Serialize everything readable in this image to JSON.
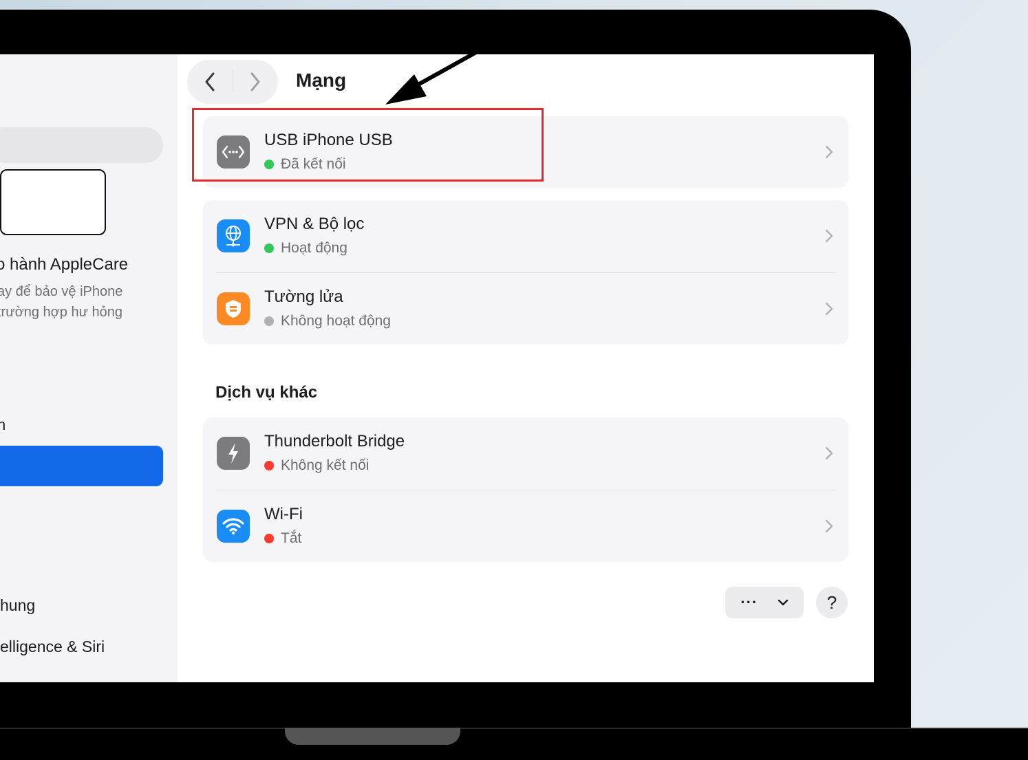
{
  "window": {
    "title": "Mạng"
  },
  "sidebar": {
    "applecare_title": "o hành AppleCare",
    "applecare_desc_line1": "ay để bảo vệ iPhone",
    "applecare_desc_line2": "trường hợp hư hỏng",
    "item_partial": "n",
    "item_general": "hung",
    "item_siri": "elligence & Siri"
  },
  "main": {
    "groups": [
      {
        "rows": [
          {
            "title": "USB iPhone USB",
            "status": "Đã kết nối",
            "status_color": "#34c759",
            "icon": "ethernet-dots-icon"
          }
        ]
      },
      {
        "rows": [
          {
            "title": "VPN & Bộ lọc",
            "status": "Hoạt động",
            "status_color": "#34c759",
            "icon": "globe-network-icon"
          },
          {
            "title": "Tường lửa",
            "status": "Không hoạt động",
            "status_color": "#b0b0b4",
            "icon": "firewall-shield-icon"
          }
        ]
      }
    ],
    "other_services_heading": "Dịch vụ khác",
    "other_services": [
      {
        "title": "Thunderbolt Bridge",
        "status": "Không kết nối",
        "status_color": "#ff3b30",
        "icon": "thunderbolt-icon"
      },
      {
        "title": "Wi-Fi",
        "status": "Tắt",
        "status_color": "#ff3b30",
        "icon": "wifi-icon"
      }
    ],
    "action_more": "···",
    "help": "?"
  },
  "colors": {
    "accent": "#1468ea",
    "highlight": "#e22a2f",
    "usb_icon": "#7b7b80",
    "vpn_icon": "#1a8cf5",
    "firewall_icon": "#fb8a24",
    "thunderbolt_icon": "#7b7b80",
    "wifi_icon": "#1a8cf5"
  }
}
